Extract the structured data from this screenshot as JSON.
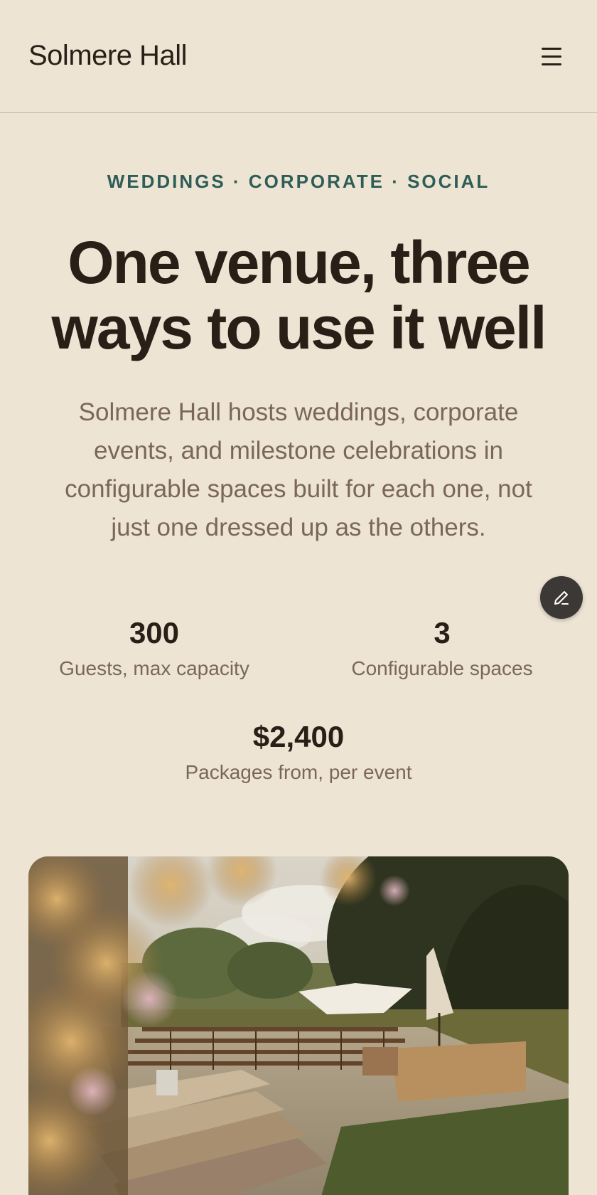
{
  "header": {
    "brand": "Solmere Hall",
    "menu_icon": "hamburger-menu-icon"
  },
  "hero": {
    "eyebrow": "WEDDINGS · CORPORATE · SOCIAL",
    "headline": "One venue, three ways to use it well",
    "lede": "Solmere Hall hosts weddings, corporate events, and milestone celebrations in configurable spaces built for each one, not just one dressed up as the others."
  },
  "stats": [
    {
      "value": "300",
      "label": "Guests, max capacity"
    },
    {
      "value": "3",
      "label": "Configurable spaces"
    },
    {
      "value": "$2,400",
      "label": "Packages from, per event"
    }
  ],
  "fab": {
    "icon": "pencil-edit-icon"
  },
  "photo": {
    "subject": "outdoor-ceremony-venue-photo"
  },
  "colors": {
    "background": "#ede4d4",
    "text": "#2a1f17",
    "muted": "#7a675a",
    "accent": "#2e5d57",
    "divider": "#c9b79c",
    "fab": "#3b3836"
  }
}
